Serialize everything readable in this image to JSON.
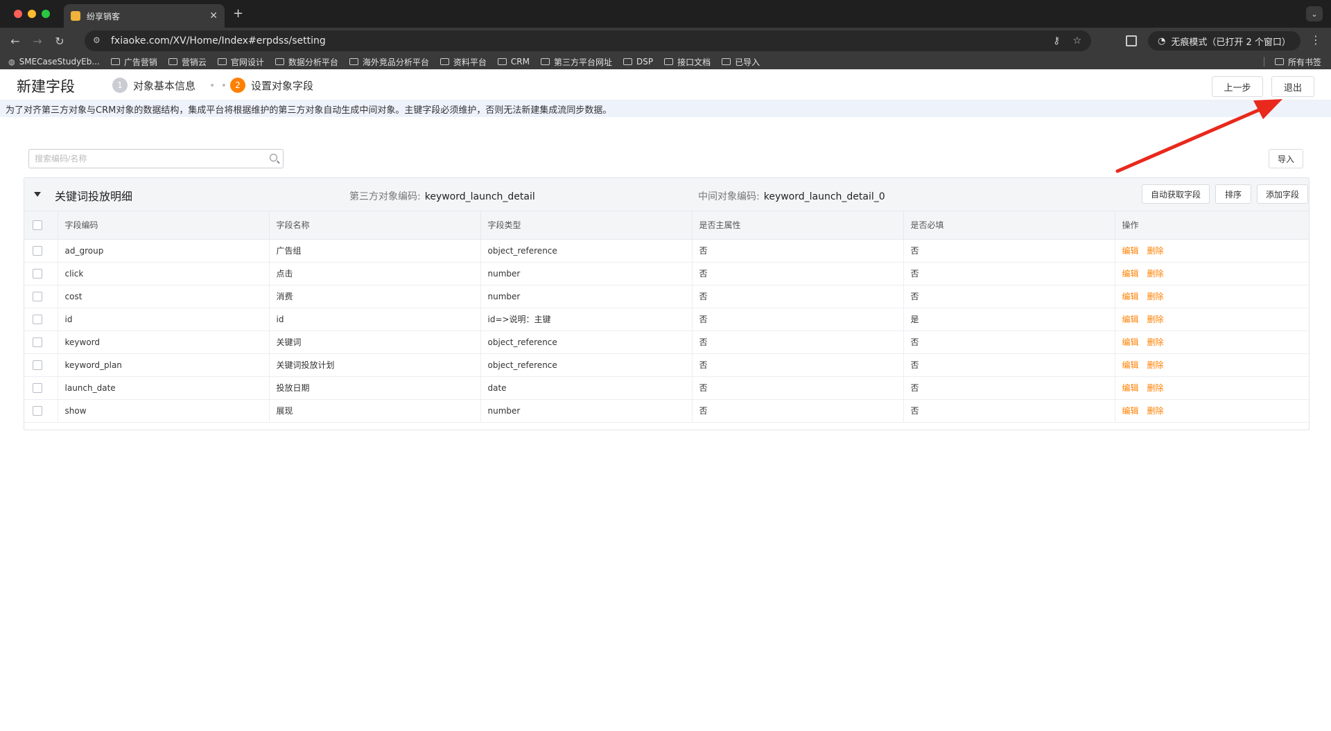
{
  "browser": {
    "tab_title": "纷享销客",
    "url": "fxiaoke.com/XV/Home/Index#erpdss/setting",
    "incognito_label": "无痕模式（已打开 2 个窗口）",
    "bookmarks": [
      "SMECaseStudyEb...",
      "广告营销",
      "营销云",
      "官网设计",
      "数据分析平台",
      "海外竞品分析平台",
      "资料平台",
      "CRM",
      "第三方平台网址",
      "DSP",
      "接口文档",
      "已导入"
    ],
    "all_bookmarks": "所有书签"
  },
  "header": {
    "title": "新建字段",
    "step1_num": "1",
    "step1_label": "对象基本信息",
    "step2_num": "2",
    "step2_label": "设置对象字段",
    "prev_label": "上一步",
    "exit_label": "退出"
  },
  "notice": "为了对齐第三方对象与CRM对象的数据结构，集成平台将根据维护的第三方对象自动生成中间对象。主键字段必须维护，否则无法新建集成流同步数据。",
  "search": {
    "placeholder": "搜索编码/名称"
  },
  "import_label": "导入",
  "group": {
    "title": "关键词投放明细",
    "third_party_label": "第三方对象编码:",
    "third_party_value": "keyword_launch_detail",
    "middle_label": "中间对象编码:",
    "middle_value": "keyword_launch_detail_0",
    "auto_fetch_label": "自动获取字段",
    "sort_label": "排序",
    "add_label": "添加字段"
  },
  "table": {
    "headers": [
      "字段编码",
      "字段名称",
      "字段类型",
      "是否主属性",
      "是否必填",
      "操作"
    ],
    "edit_label": "编辑",
    "delete_label": "删除",
    "rows": [
      [
        "ad_group",
        "广告组",
        "object_reference",
        "否",
        "否"
      ],
      [
        "click",
        "点击",
        "number",
        "否",
        "否"
      ],
      [
        "cost",
        "消费",
        "number",
        "否",
        "否"
      ],
      [
        "id",
        "id",
        "id=>说明：主键",
        "否",
        "是"
      ],
      [
        "keyword",
        "关键词",
        "object_reference",
        "否",
        "否"
      ],
      [
        "keyword_plan",
        "关键词投放计划",
        "object_reference",
        "否",
        "否"
      ],
      [
        "launch_date",
        "投放日期",
        "date",
        "否",
        "否"
      ],
      [
        "show",
        "展现",
        "number",
        "否",
        "否"
      ]
    ]
  },
  "colors": {
    "accent": "#ff8000",
    "annotation": "#e8291c"
  }
}
